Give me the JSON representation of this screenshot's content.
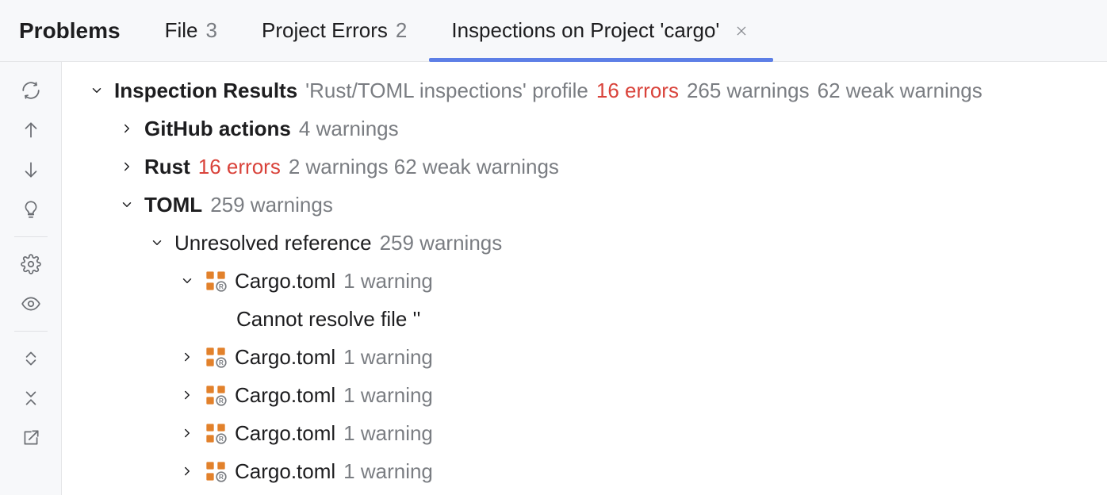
{
  "tabs": {
    "primary": "Problems",
    "file": {
      "label": "File",
      "count": "3"
    },
    "project_errors": {
      "label": "Project Errors",
      "count": "2"
    },
    "inspections": {
      "label": "Inspections on Project 'cargo'"
    }
  },
  "tree": {
    "root": {
      "title": "Inspection Results",
      "profile": "'Rust/TOML inspections' profile",
      "errors": "16 errors",
      "warnings": "265 warnings",
      "weak": "62 weak warnings"
    },
    "github": {
      "label": "GitHub actions",
      "summary": "4 warnings"
    },
    "rust": {
      "label": "Rust",
      "errors": "16 errors",
      "summary": "2 warnings 62 weak warnings"
    },
    "toml": {
      "label": "TOML",
      "summary": "259 warnings"
    },
    "unresolved": {
      "label": "Unresolved reference",
      "summary": "259 warnings"
    },
    "file_open": {
      "name": "Cargo.toml",
      "summary": "1 warning",
      "message": "Cannot resolve file ''"
    },
    "files": [
      {
        "name": "Cargo.toml",
        "summary": "1 warning"
      },
      {
        "name": "Cargo.toml",
        "summary": "1 warning"
      },
      {
        "name": "Cargo.toml",
        "summary": "1 warning"
      },
      {
        "name": "Cargo.toml",
        "summary": "1 warning"
      }
    ]
  }
}
